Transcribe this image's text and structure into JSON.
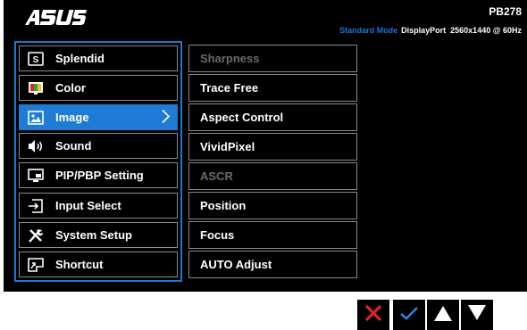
{
  "header": {
    "brand": "ASUS",
    "model": "PB278",
    "mode": "Standard Mode",
    "input": "DisplayPort",
    "resolution": "2560x1440 @ 60Hz"
  },
  "main_menu": {
    "selected_index": 2,
    "items": [
      {
        "label": "Splendid",
        "icon": "splendid-icon"
      },
      {
        "label": "Color",
        "icon": "color-icon"
      },
      {
        "label": "Image",
        "icon": "image-icon"
      },
      {
        "label": "Sound",
        "icon": "speaker-icon"
      },
      {
        "label": "PIP/PBP Setting",
        "icon": "pip-icon"
      },
      {
        "label": "Input Select",
        "icon": "input-icon"
      },
      {
        "label": "System Setup",
        "icon": "tools-icon"
      },
      {
        "label": "Shortcut",
        "icon": "shortcut-icon"
      }
    ]
  },
  "sub_menu": {
    "items": [
      {
        "label": "Sharpness",
        "enabled": false
      },
      {
        "label": "Trace Free",
        "enabled": true
      },
      {
        "label": "Aspect Control",
        "enabled": true
      },
      {
        "label": "VividPixel",
        "enabled": true
      },
      {
        "label": "ASCR",
        "enabled": false
      },
      {
        "label": "Position",
        "enabled": true
      },
      {
        "label": "Focus",
        "enabled": true
      },
      {
        "label": "AUTO Adjust",
        "enabled": true
      }
    ]
  },
  "keys": [
    {
      "name": "close-icon",
      "color": "#e5202a"
    },
    {
      "name": "check-icon",
      "color": "#2a86e0"
    },
    {
      "name": "arrow-up-icon",
      "color": "#ffffff"
    },
    {
      "name": "arrow-down-icon",
      "color": "#ffffff"
    }
  ],
  "colors": {
    "accent": "#1e7bd6",
    "disabled_text": "#6b6b6b",
    "background": "#000000"
  }
}
